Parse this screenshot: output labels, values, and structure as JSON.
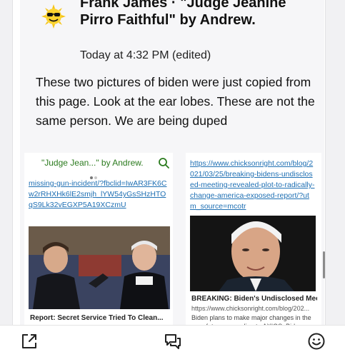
{
  "post": {
    "author": "Frank James · \"Judge Jeanine Pirro Faithful\" by Andrew.",
    "timestamp": "Today at 4:32 PM (edited)",
    "message": "These two pictures of biden were just copied from this page.  Look at the ear lobes.  These are not the same person. We are being duped"
  },
  "left_preview": {
    "title": "\"Judge Jean...\" by Andrew.",
    "link": "missing-gun-incident/?fbclid=IwAR3FK6Cw2rRHXHk6lE2smjh_lYW54yGsSHzHTOqS9Lk32vEGXP5A19XCzmU",
    "caption": "Report: Secret Service Tried To Clean..."
  },
  "right_preview": {
    "link": "https://www.chicksonright.com/blog/2021/03/25/breaking-bidens-undisclosed-meeting-revealed-plot-to-radically-change-america-exposed-report/?utm_source=mcotr",
    "headline": "BREAKING: Biden's Undisclosed Meeti...",
    "domain": "https://www.chicksonright.com/blog/202...",
    "description": "Biden plans to make major changes in the near future, according to AXIOS.  Biden..."
  },
  "toolbar": {
    "share_icon": "share-icon",
    "chat_icon": "chat-bubbles-icon",
    "emoji_icon": "emoji-icon"
  },
  "colors": {
    "link": "#1e6fb3",
    "group_title": "#2a7a1d"
  }
}
